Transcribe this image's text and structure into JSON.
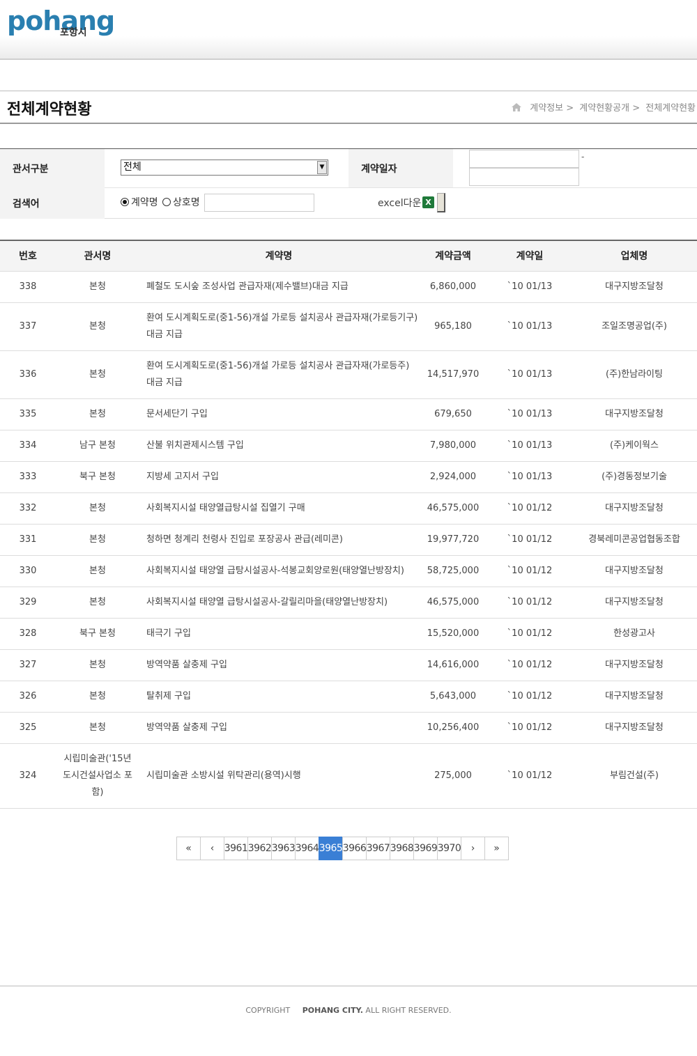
{
  "logo": {
    "text": "pohang",
    "sub": "포항시"
  },
  "page": {
    "title": "전체계약현황",
    "breadcrumb": [
      "계약정보 >",
      "계약현황공개 >",
      "전체계약현황"
    ]
  },
  "form": {
    "office_label": "관서구분",
    "office_value": "전체",
    "date_label": "계약일자",
    "date_sep": "-",
    "search_label": "검색어",
    "radio_contract": "계약명",
    "radio_company": "상호명",
    "excel_label": "excel다운"
  },
  "table": {
    "headers": [
      "번호",
      "관서명",
      "계약명",
      "계약금액",
      "계약일",
      "업체명"
    ],
    "rows": [
      {
        "no": "338",
        "office": "본청",
        "name": "폐철도 도시숲 조성사업 관급자재(제수밸브)대금 지급",
        "amount": "6,860,000",
        "date": "`10 01/13",
        "company": "대구지방조달청"
      },
      {
        "no": "337",
        "office": "본청",
        "name": "환여 도시계획도로(중1-56)개설 가로등 설치공사 관급자재(가로등기구) 대금 지급",
        "amount": "965,180",
        "date": "`10 01/13",
        "company": "조일조명공업(주)"
      },
      {
        "no": "336",
        "office": "본청",
        "name": "환여 도시계획도로(중1-56)개설 가로등 설치공사 관급자재(가로등주) 대금 지급",
        "amount": "14,517,970",
        "date": "`10 01/13",
        "company": "(주)한남라이팅"
      },
      {
        "no": "335",
        "office": "본청",
        "name": "문서세단기 구입",
        "amount": "679,650",
        "date": "`10 01/13",
        "company": "대구지방조달청"
      },
      {
        "no": "334",
        "office": "남구 본청",
        "name": "산불 위치관제시스템 구입",
        "amount": "7,980,000",
        "date": "`10 01/13",
        "company": "(주)케이웍스"
      },
      {
        "no": "333",
        "office": "북구 본청",
        "name": "지방세 고지서 구입",
        "amount": "2,924,000",
        "date": "`10 01/13",
        "company": "(주)경동정보기술"
      },
      {
        "no": "332",
        "office": "본청",
        "name": "사회복지시설 태양열급탕시설 집열기 구매",
        "amount": "46,575,000",
        "date": "`10 01/12",
        "company": "대구지방조달청"
      },
      {
        "no": "331",
        "office": "본청",
        "name": "청하면 청계리 천령사 진입로 포장공사 관급(레미콘)",
        "amount": "19,977,720",
        "date": "`10 01/12",
        "company": "경북레미콘공업협동조합"
      },
      {
        "no": "330",
        "office": "본청",
        "name": "사회복지시설 태양열 급탕시설공사-석봉교회양로원(태양열난방장치)",
        "amount": "58,725,000",
        "date": "`10 01/12",
        "company": "대구지방조달청"
      },
      {
        "no": "329",
        "office": "본청",
        "name": "사회복지시설 태양열 급탕시설공사-갈릴리마을(태양열난방장치)",
        "amount": "46,575,000",
        "date": "`10 01/12",
        "company": "대구지방조달청"
      },
      {
        "no": "328",
        "office": "북구 본청",
        "name": "태극기 구입",
        "amount": "15,520,000",
        "date": "`10 01/12",
        "company": "한성광고사"
      },
      {
        "no": "327",
        "office": "본청",
        "name": "방역약품 살충제 구입",
        "amount": "14,616,000",
        "date": "`10 01/12",
        "company": "대구지방조달청"
      },
      {
        "no": "326",
        "office": "본청",
        "name": "탈취제 구입",
        "amount": "5,643,000",
        "date": "`10 01/12",
        "company": "대구지방조달청"
      },
      {
        "no": "325",
        "office": "본청",
        "name": "방역약품 살충제 구입",
        "amount": "10,256,400",
        "date": "`10 01/12",
        "company": "대구지방조달청"
      },
      {
        "no": "324",
        "office": "시립미술관('15년 도시건설사업소 포함)",
        "name": "시립미술관 소방시설 위탁관리(용역)시행",
        "amount": "275,000",
        "date": "`10 01/12",
        "company": "부림건설(주)"
      }
    ]
  },
  "pagination": {
    "first": "«",
    "prev": "‹",
    "next": "›",
    "last": "»",
    "pages": [
      "3961",
      "3962",
      "3963",
      "3964",
      "3965",
      "3966",
      "3967",
      "3968",
      "3969",
      "3970"
    ],
    "current": "3965"
  },
  "footer": {
    "copyright_label": "COPYRIGHT",
    "org": "POHANG CITY.",
    "rights": "ALL RIGHT RESERVED."
  }
}
